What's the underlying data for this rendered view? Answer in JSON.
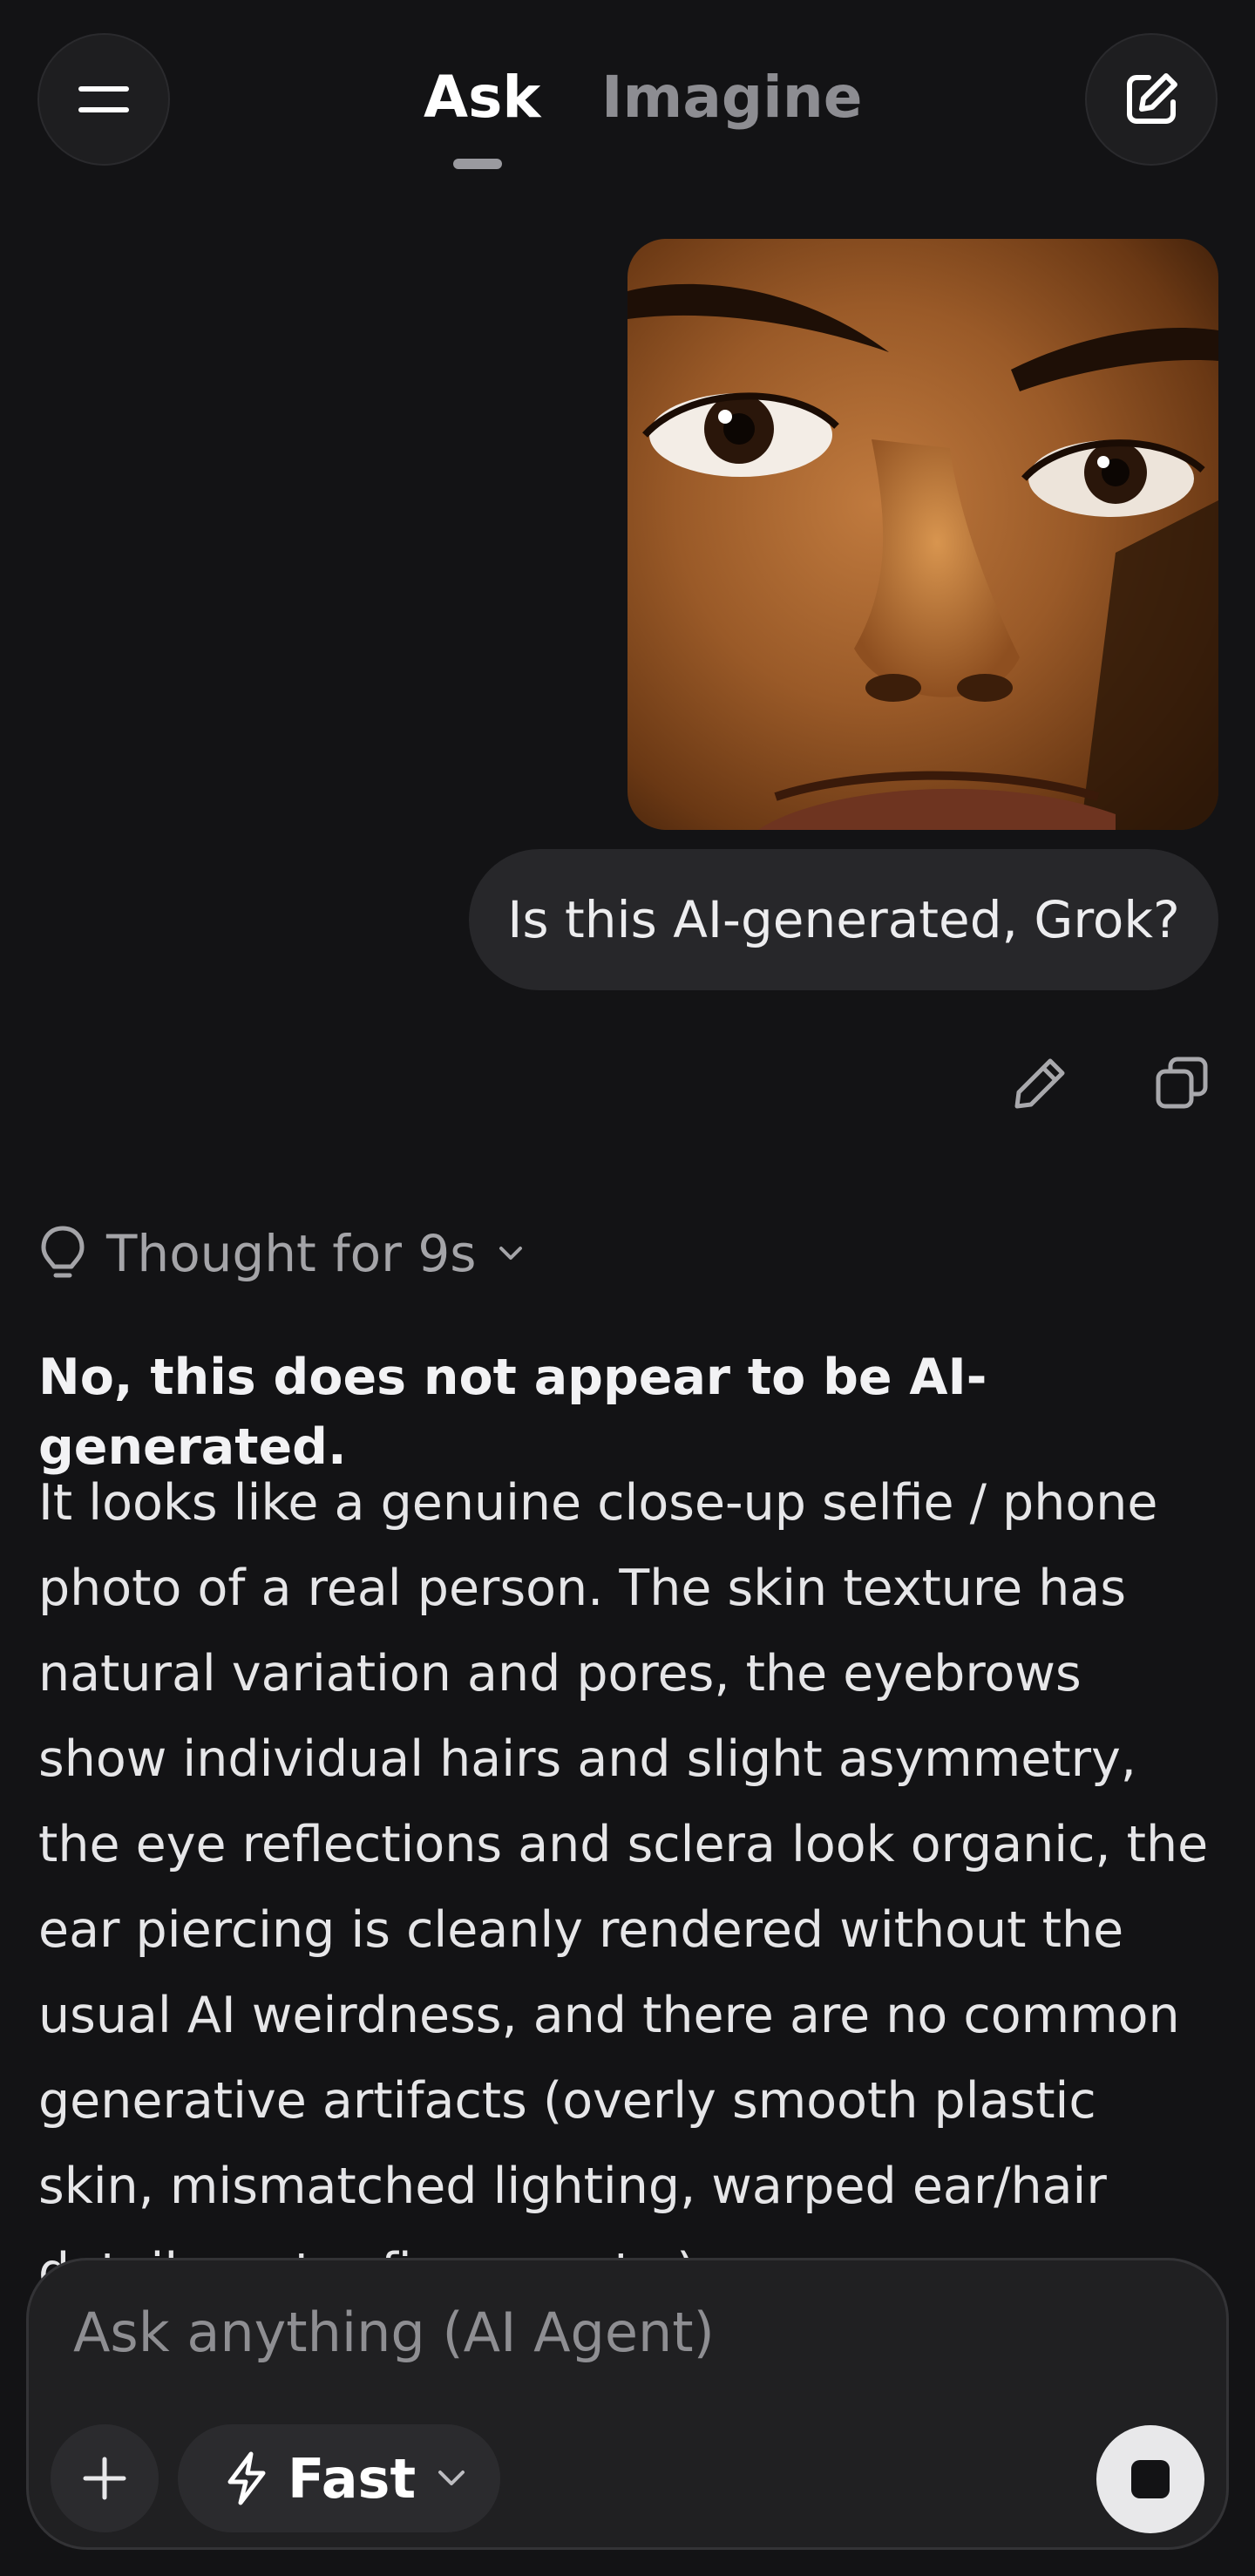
{
  "header": {
    "tabs": [
      {
        "label": "Ask",
        "active": true
      },
      {
        "label": "Imagine",
        "active": false
      }
    ],
    "menu_icon": "menu-icon",
    "compose_icon": "new-chat-icon"
  },
  "conversation": {
    "user_message": "Is this AI-generated, Grok?",
    "message_actions": [
      "edit-icon",
      "copy-icon"
    ],
    "thought": {
      "label": "Thought for 9s",
      "icon": "lightbulb-icon"
    },
    "answer_heading": "No, this does not appear to be AI-generated.",
    "answer_body": "It looks like a genuine close-up selfie / phone photo of a real person. The skin texture has natural variation and pores, the eyebrows show individual hairs and slight asymmetry, the eye reflections and sclera look organic, the ear piercing is cleanly rendered without the usual AI weirdness, and there are no common generative artifacts (overly smooth plastic skin, mismatched lighting, warped ear/hair details, extra fingers, etc.)."
  },
  "composer": {
    "placeholder": "Ask anything (AI Agent)",
    "mode_label": "Fast",
    "plus_icon": "plus-icon",
    "mode_icon": "lightning-icon",
    "stop_icon": "stop-icon"
  },
  "colors": {
    "background": "#131315",
    "bubble": "#27272A",
    "composer": "#202022",
    "text": "#ECECEE",
    "muted": "#8D8D92"
  }
}
